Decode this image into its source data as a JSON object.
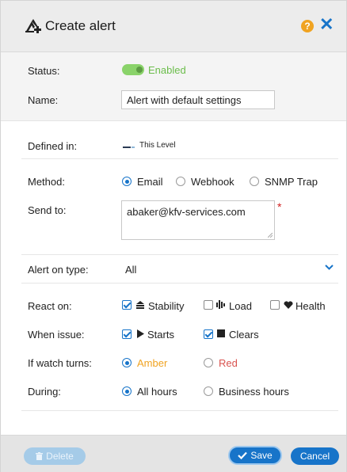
{
  "dialog": {
    "title": "Create alert",
    "title_icon": "add-alert-icon",
    "help_icon": "help-icon",
    "close_icon": "close-icon"
  },
  "status": {
    "label": "Status:",
    "value": "Enabled",
    "enabled": true
  },
  "name": {
    "label": "Name:",
    "value": "Alert with default settings"
  },
  "defined_in": {
    "label": "Defined in:",
    "value": "This Level"
  },
  "method": {
    "label": "Method:",
    "options": [
      "Email",
      "Webhook",
      "SNMP Trap"
    ],
    "selected": "Email"
  },
  "send_to": {
    "label": "Send to:",
    "value": "abaker@kfv-services.com",
    "required_mark": "*"
  },
  "alert_on_type": {
    "label": "Alert on type:",
    "value": "All"
  },
  "react_on": {
    "label": "React on:",
    "options": [
      {
        "label": "Stability",
        "icon": "stability-icon",
        "checked": true
      },
      {
        "label": "Load",
        "icon": "load-icon",
        "checked": false
      },
      {
        "label": "Health",
        "icon": "heart-icon",
        "checked": false
      }
    ]
  },
  "when_issue": {
    "label": "When issue:",
    "options": [
      {
        "label": "Starts",
        "icon": "play-icon",
        "checked": true
      },
      {
        "label": "Clears",
        "icon": "stop-icon",
        "checked": true
      }
    ]
  },
  "if_watch_turns": {
    "label": "If watch turns:",
    "options": [
      {
        "label": "Amber",
        "color": "#f0a321",
        "selected": true
      },
      {
        "label": "Red",
        "color": "#d9534f",
        "selected": false
      }
    ]
  },
  "during": {
    "label": "During:",
    "options": [
      "All hours",
      "Business hours"
    ],
    "selected": "All hours"
  },
  "footer": {
    "delete": "Delete",
    "save": "Save",
    "cancel": "Cancel"
  },
  "colors": {
    "accent": "#1774c9",
    "enabled": "#6bbd4b",
    "help": "#f0a321"
  }
}
